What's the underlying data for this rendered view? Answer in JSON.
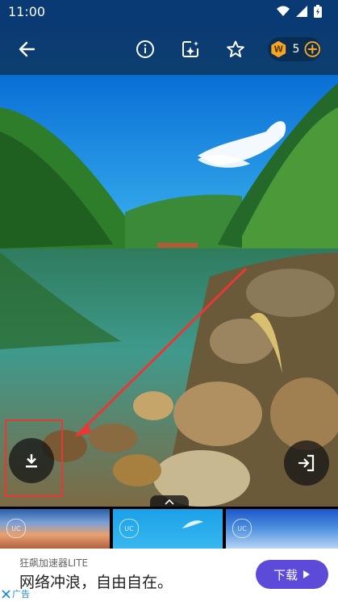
{
  "status_bar": {
    "time": "11:00"
  },
  "toolbar": {
    "coin_count": "5",
    "coin_symbol": "W"
  },
  "thumbnails": [
    {
      "badge": "UC"
    },
    {
      "badge": "UC"
    },
    {
      "badge": "UC"
    }
  ],
  "ad": {
    "title": "狂飙加速器LITE",
    "text": "网络冲浪，自由自在。",
    "cta": "下载",
    "label": "广告"
  },
  "colors": {
    "accent": "#5b4bd8",
    "highlight": "#e53935",
    "coin": "#f5a623"
  }
}
